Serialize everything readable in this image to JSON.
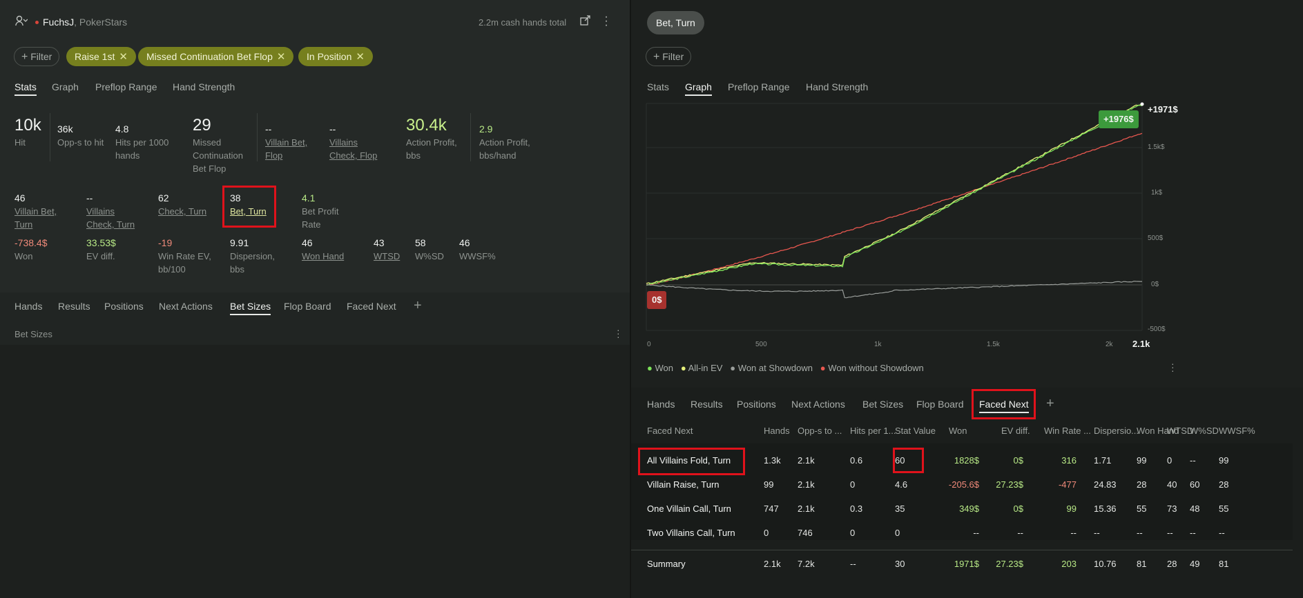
{
  "left": {
    "header": {
      "user": "FuchsJ",
      "site": ", PokerStars",
      "hands_total": "2.2m cash hands total"
    },
    "filter_label": "Filter",
    "chips": [
      "Raise 1st",
      "Missed Continuation Bet Flop",
      "In Position"
    ],
    "tabs": [
      "Stats",
      "Graph",
      "Preflop Range",
      "Hand Strength"
    ],
    "stats_row1": [
      {
        "value": "10k",
        "label": "Hit"
      },
      {
        "value": "36k",
        "label": "Opp-s to hit"
      },
      {
        "value": "4.8",
        "label": "Hits per 1000 hands"
      },
      {
        "value": "29",
        "label": "Missed Continuation Bet Flop"
      },
      {
        "value": "--",
        "label": "Villain Bet, Flop"
      },
      {
        "value": "--",
        "label": "Villains Check, Flop"
      },
      {
        "value": "30.4k",
        "label": "Action Profit, bbs"
      },
      {
        "value": "2.9",
        "label": "Action Profit, bbs/hand"
      }
    ],
    "stats_row2": [
      {
        "value": "46",
        "label": "Villain Bet, Turn"
      },
      {
        "value": "--",
        "label": "Villains Check, Turn"
      },
      {
        "value": "62",
        "label": "Check, Turn"
      },
      {
        "value": "38",
        "label": "Bet, Turn"
      },
      {
        "value": "4.1",
        "label": "Bet Profit Rate"
      }
    ],
    "stats_row3": [
      {
        "value": "-738.4$",
        "label": "Won"
      },
      {
        "value": "33.53$",
        "label": "EV diff."
      },
      {
        "value": "-19",
        "label": "Win Rate EV, bb/100"
      },
      {
        "value": "9.91",
        "label": "Dispersion, bbs"
      },
      {
        "value": "46",
        "label": "Won Hand"
      },
      {
        "value": "43",
        "label": "WTSD"
      },
      {
        "value": "58",
        "label": "W%SD"
      },
      {
        "value": "46",
        "label": "WWSF%"
      }
    ],
    "bottom_tabs": [
      "Hands",
      "Results",
      "Positions",
      "Next Actions",
      "Bet Sizes",
      "Flop Board",
      "Faced Next"
    ],
    "section_title": "Bet Sizes"
  },
  "right": {
    "title_chip": "Bet, Turn",
    "filter_label": "Filter",
    "tabs": [
      "Stats",
      "Graph",
      "Preflop Range",
      "Hand Strength"
    ],
    "graph": {
      "y_ticks": [
        "1.5k$",
        "1k$",
        "500$",
        "0$",
        "-500$"
      ],
      "x_ticks": [
        "0",
        "500",
        "1k",
        "1.5k",
        "2k"
      ],
      "x_end": "2.1k",
      "badge_end": "+1971$",
      "badge_green": "+1976$",
      "badge_start": "0$",
      "legend": [
        "Won",
        "All-in EV",
        "Won at Showdown",
        "Won without Showdown"
      ],
      "colors": {
        "won": "#7de35a",
        "allin": "#e6f07a",
        "showdown": "#9a9e9b",
        "noshowdown": "#e8574f"
      }
    },
    "bottom_tabs": [
      "Hands",
      "Results",
      "Positions",
      "Next Actions",
      "Bet Sizes",
      "Flop Board",
      "Faced Next"
    ],
    "table": {
      "headers": [
        "Faced Next",
        "Hands",
        "Opp-s to ...",
        "Hits per 1...",
        "Stat Value",
        "Won",
        "EV diff.",
        "Win Rate ...",
        "Dispersio...",
        "Won Hand",
        "WTSD",
        "W%SD",
        "WWSF%"
      ],
      "rows": [
        [
          "All Villains Fold, Turn",
          "1.3k",
          "2.1k",
          "0.6",
          "60",
          "1828$",
          "0$",
          "316",
          "1.71",
          "99",
          "0",
          "--",
          "99"
        ],
        [
          "Villain Raise, Turn",
          "99",
          "2.1k",
          "0",
          "4.6",
          "-205.6$",
          "27.23$",
          "-477",
          "24.83",
          "28",
          "40",
          "60",
          "28"
        ],
        [
          "One Villain Call, Turn",
          "747",
          "2.1k",
          "0.3",
          "35",
          "349$",
          "0$",
          "99",
          "15.36",
          "55",
          "73",
          "48",
          "55"
        ],
        [
          "Two Villains Call, Turn",
          "0",
          "746",
          "0",
          "0",
          "--",
          "--",
          "--",
          "--",
          "--",
          "--",
          "--",
          "--"
        ]
      ],
      "summary": [
        "Summary",
        "2.1k",
        "7.2k",
        "--",
        "30",
        "1971$",
        "27.23$",
        "203",
        "10.76",
        "81",
        "28",
        "49",
        "81"
      ]
    }
  }
}
